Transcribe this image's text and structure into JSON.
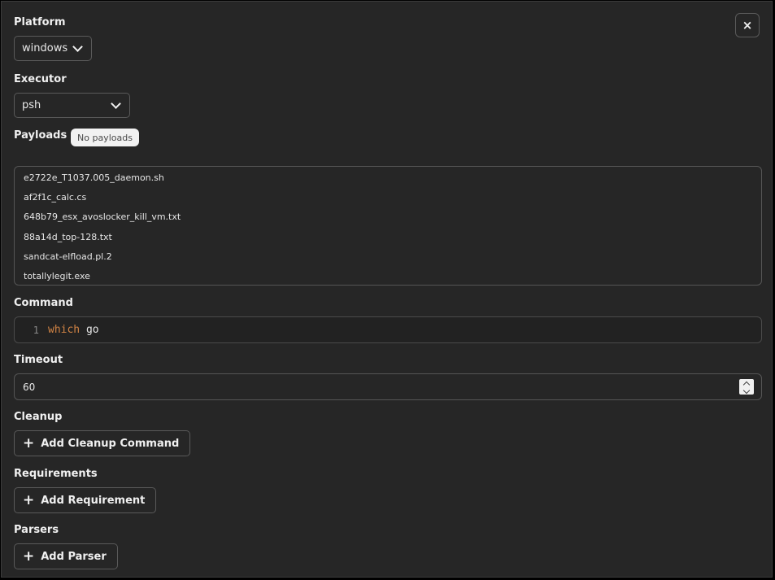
{
  "close_label": "×",
  "platform": {
    "label": "Platform",
    "value": "windows"
  },
  "executor": {
    "label": "Executor",
    "value": "psh"
  },
  "payloads": {
    "label": "Payloads",
    "badge": "No payloads",
    "items": [
      "e2722e_T1037.005_daemon.sh",
      "af2f1c_calc.cs",
      "648b79_esx_avoslocker_kill_vm.txt",
      "88a14d_top-128.txt",
      "sandcat-elfload.pl.2",
      "totallylegit.exe"
    ]
  },
  "command": {
    "label": "Command",
    "line_number": "1",
    "keyword": "which",
    "rest": " go"
  },
  "timeout": {
    "label": "Timeout",
    "value": "60"
  },
  "cleanup": {
    "label": "Cleanup",
    "button": "Add Cleanup Command"
  },
  "requirements": {
    "label": "Requirements",
    "button": "Add Requirement"
  },
  "parsers": {
    "label": "Parsers",
    "button": "Add Parser"
  },
  "icons": {
    "close": "close-icon",
    "chevron": "chevron-down-icon",
    "plus": "plus-icon",
    "spinner": "spinner-arrows-icon"
  }
}
